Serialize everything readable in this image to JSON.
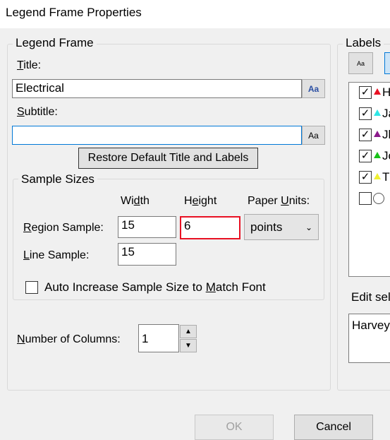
{
  "window": {
    "title": "Legend Frame Properties"
  },
  "legend_frame": {
    "caption": "Legend Frame",
    "title_label": "Title:",
    "title_value": "Electrical",
    "subtitle_label": "Subtitle:",
    "subtitle_value": "",
    "font_button_label": "Aa",
    "restore_button_label": "Restore Default Title and Labels"
  },
  "sample_sizes": {
    "caption": "Sample Sizes",
    "width_header": "Width",
    "height_header": "Height",
    "units_header": "Paper Units:",
    "region_label": "Region Sample:",
    "region_width": "15",
    "region_height": "6",
    "line_label": "Line Sample:",
    "line_width": "15",
    "units_value": "points",
    "auto_increase_label": "Auto Increase Sample Size to Match Font",
    "auto_increase_checked": false
  },
  "columns": {
    "label": "Number of Columns:",
    "value": "1"
  },
  "labels_panel": {
    "caption": "Labels",
    "font_button_label": "Aa",
    "items": [
      {
        "name": "H",
        "checked": true,
        "color": "#e81123"
      },
      {
        "name": "Ja",
        "checked": true,
        "color": "#2ee6e6"
      },
      {
        "name": "Jl",
        "checked": true,
        "color": "#8b1a8b"
      },
      {
        "name": "Jc",
        "checked": true,
        "color": "#19c219"
      },
      {
        "name": "T",
        "checked": true,
        "color": "#f0f032"
      },
      {
        "name": "",
        "checked": false,
        "color": "#ffffff"
      }
    ],
    "edit_label": "Edit sel",
    "edit_value": "Harvey"
  },
  "footer": {
    "ok_label": "OK",
    "cancel_label": "Cancel"
  }
}
